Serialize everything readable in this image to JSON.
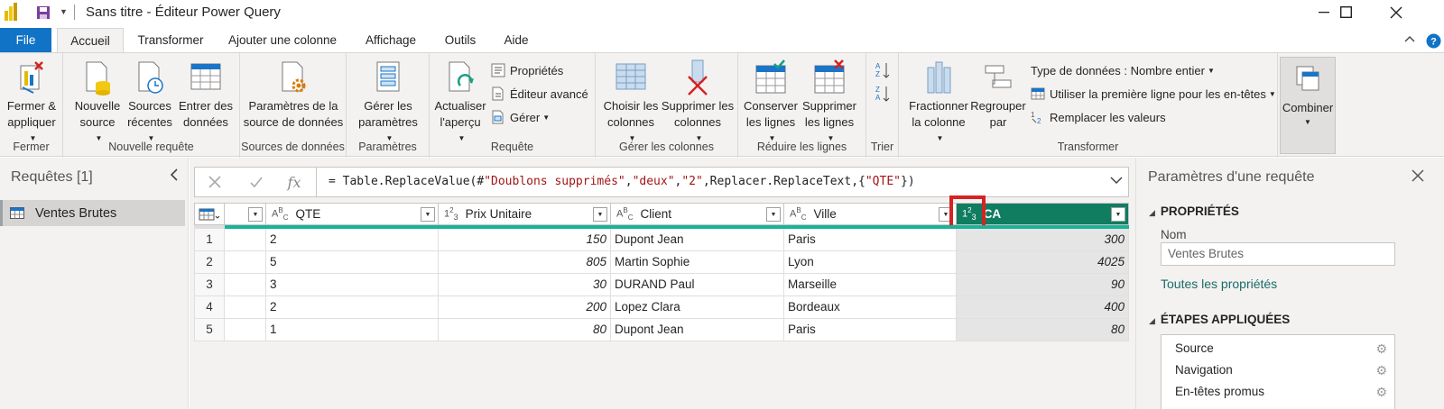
{
  "window": {
    "title": "Sans titre - Éditeur Power Query",
    "minimize": "—",
    "maximize": "☐",
    "close": "✕"
  },
  "tabs": [
    {
      "label": "File"
    },
    {
      "label": "Accueil"
    },
    {
      "label": "Transformer"
    },
    {
      "label": "Ajouter une colonne"
    },
    {
      "label": "Affichage"
    },
    {
      "label": "Outils"
    },
    {
      "label": "Aide"
    }
  ],
  "ribbon": {
    "fermer": {
      "btn1": "Fermer &",
      "btn2": "appliquer",
      "label": "Fermer"
    },
    "nouvelle": {
      "nouvelle1": "Nouvelle",
      "nouvelle2": "source",
      "recentes1": "Sources",
      "recentes2": "récentes",
      "entrer1": "Entrer des",
      "entrer2": "données",
      "label": "Nouvelle requête"
    },
    "sources": {
      "btn1": "Paramètres de la",
      "btn2": "source de données",
      "label": "Sources de données"
    },
    "parametres": {
      "btn1": "Gérer les",
      "btn2": "paramètres",
      "label": "Paramètres"
    },
    "requete": {
      "actualiser1": "Actualiser",
      "actualiser2": "l'aperçu",
      "proprietes": "Propriétés",
      "editeur": "Éditeur avancé",
      "gerer": "Gérer",
      "label": "Requête"
    },
    "colonnes": {
      "choisir1": "Choisir les",
      "choisir2": "colonnes",
      "supprimer1": "Supprimer les",
      "supprimer2": "colonnes",
      "label": "Gérer les colonnes"
    },
    "lignes": {
      "conserver1": "Conserver",
      "conserver2": "les lignes",
      "supprimer1": "Supprimer",
      "supprimer2": "les lignes",
      "label": "Réduire les lignes"
    },
    "trier": {
      "label": "Trier"
    },
    "transformer": {
      "fractionner1": "Fractionner",
      "fractionner2": "la colonne",
      "regrouper1": "Regrouper",
      "regrouper2": "par",
      "type": "Type de données : Nombre entier",
      "premiere": "Utiliser la première ligne pour les en-têtes",
      "remplacer": "Remplacer les valeurs",
      "label": "Transformer"
    },
    "combiner": {
      "label": "Combiner"
    }
  },
  "left_pane": {
    "title": "Requêtes [1]",
    "queries": [
      {
        "name": "Ventes Brutes"
      }
    ]
  },
  "formula_bar": {
    "prefix": "= Table.ReplaceValue(#",
    "s1": "\"Doublons supprimés\"",
    "c1": ",",
    "s2": "\"deux\"",
    "c2": ",",
    "s3": "\"2\"",
    "mid": ",Replacer.ReplaceText,{",
    "s4": "\"QTE\"",
    "end": "})"
  },
  "grid": {
    "columns": [
      {
        "type": "ABC",
        "name": "QTE"
      },
      {
        "type": "123",
        "name": "Prix Unitaire"
      },
      {
        "type": "ABC",
        "name": "Client"
      },
      {
        "type": "ABC",
        "name": "Ville"
      },
      {
        "type": "123",
        "name": "CA"
      }
    ],
    "rows": [
      {
        "n": "1",
        "qte": "2",
        "prix": "150",
        "client": "Dupont Jean",
        "ville": "Paris",
        "ca": "300"
      },
      {
        "n": "2",
        "qte": "5",
        "prix": "805",
        "client": "Martin Sophie",
        "ville": "Lyon",
        "ca": "4025"
      },
      {
        "n": "3",
        "qte": "3",
        "prix": "30",
        "client": "DURAND Paul",
        "ville": "Marseille",
        "ca": "90"
      },
      {
        "n": "4",
        "qte": "2",
        "prix": "200",
        "client": "Lopez Clara",
        "ville": "Bordeaux",
        "ca": "400"
      },
      {
        "n": "5",
        "qte": "1",
        "prix": "80",
        "client": "Dupont Jean",
        "ville": "Paris",
        "ca": "80"
      }
    ]
  },
  "right_pane": {
    "title": "Paramètres d'une requête",
    "properties_header": "PROPRIÉTÉS",
    "name_label": "Nom",
    "name_value": "Ventes Brutes",
    "all_props": "Toutes les propriétés",
    "steps_header": "ÉTAPES APPLIQUÉES",
    "steps": [
      {
        "name": "Source"
      },
      {
        "name": "Navigation"
      },
      {
        "name": "En-têtes promus"
      }
    ]
  },
  "colors": {
    "file_tab": "#1173c6",
    "ca_header": "#107c60",
    "teal": "#1ab39a",
    "highlight": "#d62222"
  }
}
